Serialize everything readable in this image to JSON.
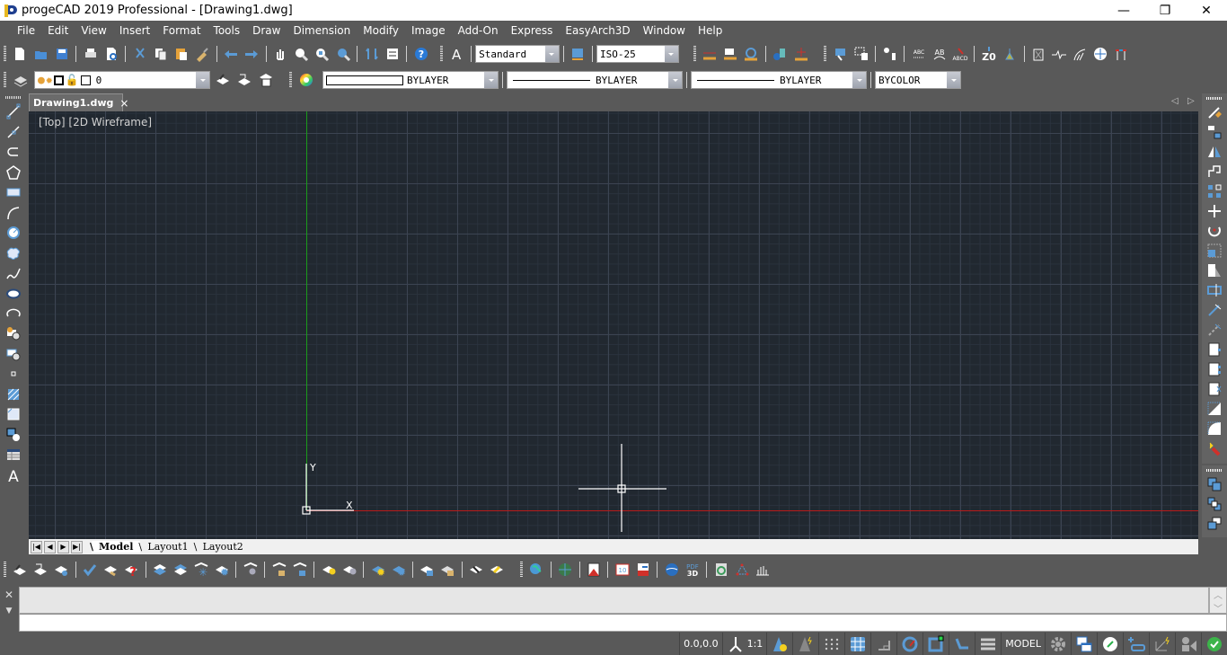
{
  "titlebar": {
    "title": "progeCAD 2019 Professional - [Drawing1.dwg]",
    "minimize": "—",
    "restore": "❐",
    "close": "✕"
  },
  "menubar": {
    "items": [
      "File",
      "Edit",
      "View",
      "Insert",
      "Format",
      "Tools",
      "Draw",
      "Dimension",
      "Modify",
      "Image",
      "Add-On",
      "Express",
      "EasyArch3D",
      "Window",
      "Help"
    ]
  },
  "standard_toolbar": {
    "text_style": "Standard",
    "dim_style": "ISO-25"
  },
  "properties_toolbar": {
    "layer": "0",
    "color": "BYLAYER",
    "linetype": "BYLAYER",
    "lineweight": "BYLAYER",
    "plot_style": "BYCOLOR"
  },
  "document": {
    "tab_label": "Drawing1.dwg",
    "tab_close": "×",
    "viewport_label": "[Top] [2D Wireframe]",
    "ucs_x": "X",
    "ucs_y": "Y"
  },
  "layout_tabs": {
    "nav": [
      "|◀",
      "◀",
      "▶",
      "▶|"
    ],
    "tabs": [
      {
        "label": "Model",
        "active": true
      },
      {
        "label": "Layout1",
        "active": false
      },
      {
        "label": "Layout2",
        "active": false
      }
    ]
  },
  "command": {
    "close": "✕",
    "menu": "▼",
    "history": "",
    "input": ""
  },
  "statusbar": {
    "coordinates": "0.0,0.0",
    "scale": "1:1",
    "space": "MODEL"
  },
  "colors": {
    "canvas_bg": "#212830",
    "x_axis": "#b81a1a",
    "y_axis": "#1a9a1a",
    "chrome": "#595959",
    "icon_blue": "#5b9bd5"
  }
}
